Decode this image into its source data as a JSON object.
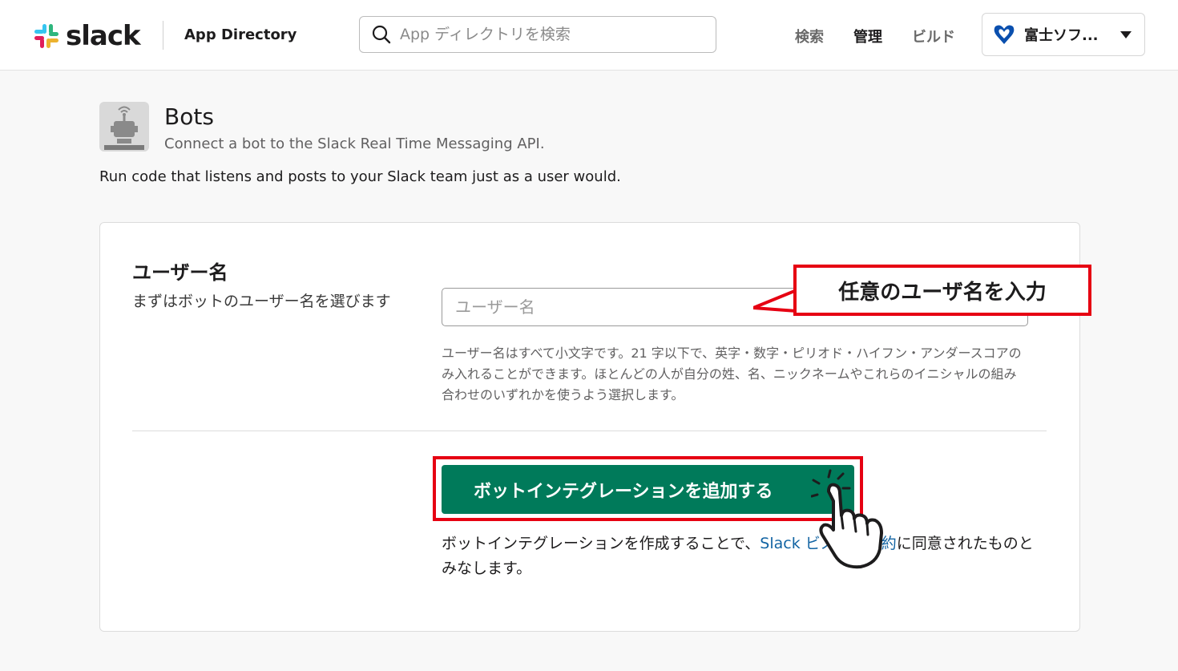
{
  "header": {
    "logo_text": "slack",
    "app_directory": "App Directory",
    "search_placeholder": "App ディレクトリを検索",
    "nav": {
      "search": "検索",
      "admin": "管理",
      "build": "ビルド"
    },
    "workspace_name": "富士ソフ..."
  },
  "app": {
    "title": "Bots",
    "subtitle": "Connect a bot to the Slack Real Time Messaging API.",
    "description": "Run code that listens and posts to your Slack team just as a user would."
  },
  "form": {
    "field_title": "ユーザー名",
    "field_desc": "まずはボットのユーザー名を選びます",
    "input_placeholder": "ユーザー名",
    "hint": "ユーザー名はすべて小文字です。21 字以下で、英字・数字・ピリオド・ハイフン・アンダースコアのみ入れることができます。ほとんどの人が自分の姓、名、ニックネームやこれらのイニシャルの組み合わせのいずれかを使うよう選択します。",
    "add_button": "ボットインテグレーションを追加する",
    "terms_prefix": "ボットインテグレーションを作成することで、",
    "terms_link_1": "Slack ",
    "terms_link_2": "ビス利用規約",
    "terms_suffix": "に同意されたものとみなします。"
  },
  "annotation": {
    "callout_text": "任意のユーザ名を入力",
    "highlight_color": "#e60012"
  },
  "colors": {
    "button_green": "#007a5a",
    "link_blue": "#1264a3"
  }
}
